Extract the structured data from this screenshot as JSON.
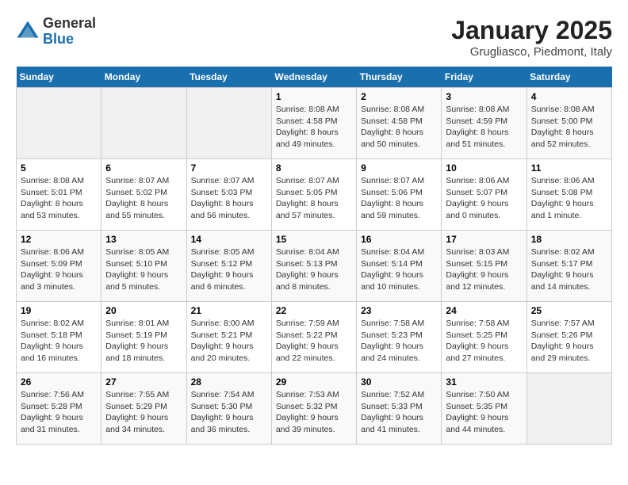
{
  "logo": {
    "general": "General",
    "blue": "Blue"
  },
  "title": "January 2025",
  "subtitle": "Grugliasco, Piedmont, Italy",
  "weekdays": [
    "Sunday",
    "Monday",
    "Tuesday",
    "Wednesday",
    "Thursday",
    "Friday",
    "Saturday"
  ],
  "weeks": [
    [
      {
        "day": "",
        "info": ""
      },
      {
        "day": "",
        "info": ""
      },
      {
        "day": "",
        "info": ""
      },
      {
        "day": "1",
        "info": "Sunrise: 8:08 AM\nSunset: 4:58 PM\nDaylight: 8 hours\nand 49 minutes."
      },
      {
        "day": "2",
        "info": "Sunrise: 8:08 AM\nSunset: 4:58 PM\nDaylight: 8 hours\nand 50 minutes."
      },
      {
        "day": "3",
        "info": "Sunrise: 8:08 AM\nSunset: 4:59 PM\nDaylight: 8 hours\nand 51 minutes."
      },
      {
        "day": "4",
        "info": "Sunrise: 8:08 AM\nSunset: 5:00 PM\nDaylight: 8 hours\nand 52 minutes."
      }
    ],
    [
      {
        "day": "5",
        "info": "Sunrise: 8:08 AM\nSunset: 5:01 PM\nDaylight: 8 hours\nand 53 minutes."
      },
      {
        "day": "6",
        "info": "Sunrise: 8:07 AM\nSunset: 5:02 PM\nDaylight: 8 hours\nand 55 minutes."
      },
      {
        "day": "7",
        "info": "Sunrise: 8:07 AM\nSunset: 5:03 PM\nDaylight: 8 hours\nand 56 minutes."
      },
      {
        "day": "8",
        "info": "Sunrise: 8:07 AM\nSunset: 5:05 PM\nDaylight: 8 hours\nand 57 minutes."
      },
      {
        "day": "9",
        "info": "Sunrise: 8:07 AM\nSunset: 5:06 PM\nDaylight: 8 hours\nand 59 minutes."
      },
      {
        "day": "10",
        "info": "Sunrise: 8:06 AM\nSunset: 5:07 PM\nDaylight: 9 hours\nand 0 minutes."
      },
      {
        "day": "11",
        "info": "Sunrise: 8:06 AM\nSunset: 5:08 PM\nDaylight: 9 hours\nand 1 minute."
      }
    ],
    [
      {
        "day": "12",
        "info": "Sunrise: 8:06 AM\nSunset: 5:09 PM\nDaylight: 9 hours\nand 3 minutes."
      },
      {
        "day": "13",
        "info": "Sunrise: 8:05 AM\nSunset: 5:10 PM\nDaylight: 9 hours\nand 5 minutes."
      },
      {
        "day": "14",
        "info": "Sunrise: 8:05 AM\nSunset: 5:12 PM\nDaylight: 9 hours\nand 6 minutes."
      },
      {
        "day": "15",
        "info": "Sunrise: 8:04 AM\nSunset: 5:13 PM\nDaylight: 9 hours\nand 8 minutes."
      },
      {
        "day": "16",
        "info": "Sunrise: 8:04 AM\nSunset: 5:14 PM\nDaylight: 9 hours\nand 10 minutes."
      },
      {
        "day": "17",
        "info": "Sunrise: 8:03 AM\nSunset: 5:15 PM\nDaylight: 9 hours\nand 12 minutes."
      },
      {
        "day": "18",
        "info": "Sunrise: 8:02 AM\nSunset: 5:17 PM\nDaylight: 9 hours\nand 14 minutes."
      }
    ],
    [
      {
        "day": "19",
        "info": "Sunrise: 8:02 AM\nSunset: 5:18 PM\nDaylight: 9 hours\nand 16 minutes."
      },
      {
        "day": "20",
        "info": "Sunrise: 8:01 AM\nSunset: 5:19 PM\nDaylight: 9 hours\nand 18 minutes."
      },
      {
        "day": "21",
        "info": "Sunrise: 8:00 AM\nSunset: 5:21 PM\nDaylight: 9 hours\nand 20 minutes."
      },
      {
        "day": "22",
        "info": "Sunrise: 7:59 AM\nSunset: 5:22 PM\nDaylight: 9 hours\nand 22 minutes."
      },
      {
        "day": "23",
        "info": "Sunrise: 7:58 AM\nSunset: 5:23 PM\nDaylight: 9 hours\nand 24 minutes."
      },
      {
        "day": "24",
        "info": "Sunrise: 7:58 AM\nSunset: 5:25 PM\nDaylight: 9 hours\nand 27 minutes."
      },
      {
        "day": "25",
        "info": "Sunrise: 7:57 AM\nSunset: 5:26 PM\nDaylight: 9 hours\nand 29 minutes."
      }
    ],
    [
      {
        "day": "26",
        "info": "Sunrise: 7:56 AM\nSunset: 5:28 PM\nDaylight: 9 hours\nand 31 minutes."
      },
      {
        "day": "27",
        "info": "Sunrise: 7:55 AM\nSunset: 5:29 PM\nDaylight: 9 hours\nand 34 minutes."
      },
      {
        "day": "28",
        "info": "Sunrise: 7:54 AM\nSunset: 5:30 PM\nDaylight: 9 hours\nand 36 minutes."
      },
      {
        "day": "29",
        "info": "Sunrise: 7:53 AM\nSunset: 5:32 PM\nDaylight: 9 hours\nand 39 minutes."
      },
      {
        "day": "30",
        "info": "Sunrise: 7:52 AM\nSunset: 5:33 PM\nDaylight: 9 hours\nand 41 minutes."
      },
      {
        "day": "31",
        "info": "Sunrise: 7:50 AM\nSunset: 5:35 PM\nDaylight: 9 hours\nand 44 minutes."
      },
      {
        "day": "",
        "info": ""
      }
    ]
  ]
}
